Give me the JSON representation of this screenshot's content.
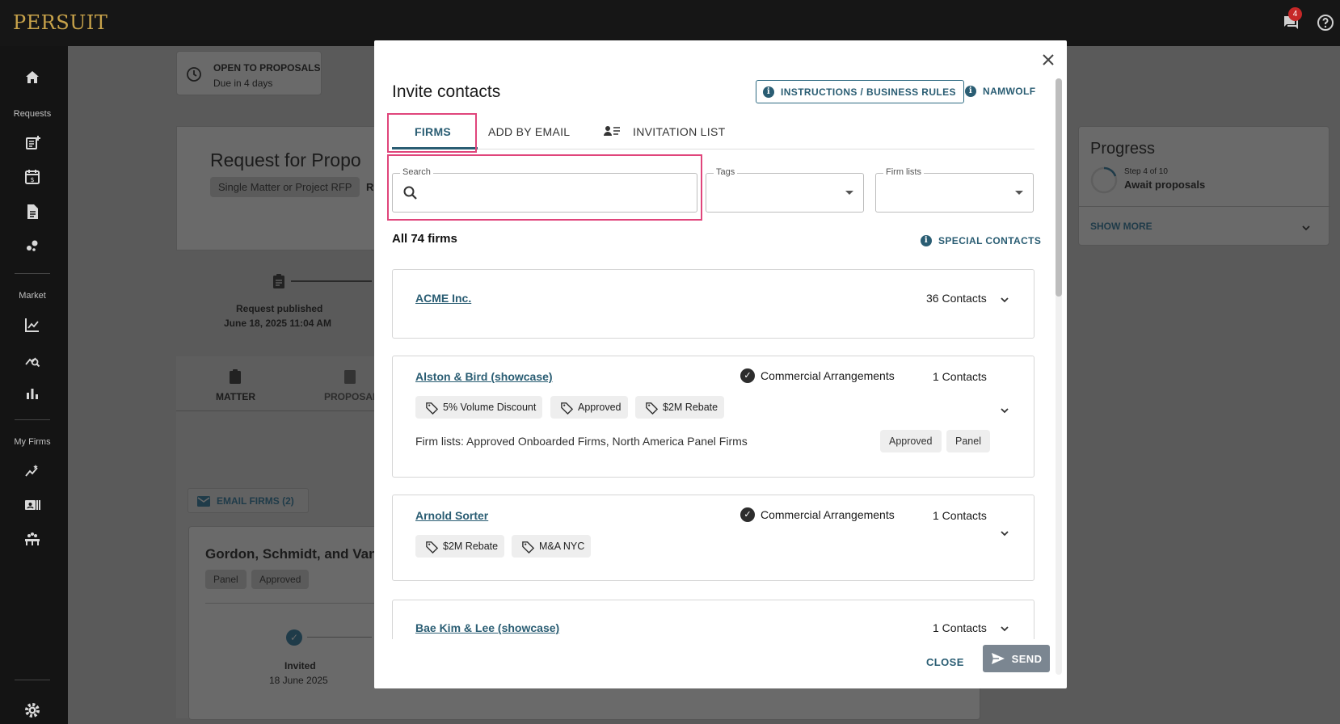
{
  "app": {
    "logo": "PERSUIT",
    "notifications_count": "4"
  },
  "sidebar": {
    "sections": {
      "requests": "Requests",
      "market": "Market",
      "my_firms": "My Firms"
    }
  },
  "background": {
    "status": {
      "title": "OPEN TO PROPOSALS",
      "due": "Due in 4 days"
    },
    "request_title": "Request for Propo",
    "type_chip": "Single Matter or Project RFP",
    "type_chip_more": "R",
    "timeline": {
      "published_label": "Request published",
      "published_date": "June 18, 2025 11:04 AM"
    },
    "tabs": [
      "MATTER",
      "PROPOSAL"
    ],
    "email_firms": "EMAIL FIRMS (2)",
    "firm_card": {
      "name": "Gordon, Schmidt, and Van",
      "chips": [
        "Panel",
        "Approved"
      ],
      "step_label": "Invited",
      "step_date": "18 June 2025"
    },
    "progress": {
      "title": "Progress",
      "step": "Step 4 of 10",
      "step_name": "Await proposals",
      "show_more": "SHOW MORE"
    }
  },
  "modal": {
    "title": "Invite contacts",
    "instructions_button": "INSTRUCTIONS / BUSINESS RULES",
    "namwolf_button": "NAMWOLF",
    "tabs": [
      {
        "label": "FIRMS",
        "active": true
      },
      {
        "label": "ADD BY EMAIL",
        "active": false
      },
      {
        "label": "INVITATION LIST",
        "active": false
      }
    ],
    "filters": {
      "search_label": "Search",
      "search_value": "",
      "tags_label": "Tags",
      "tags_value": "",
      "firm_lists_label": "Firm lists",
      "firm_lists_value": ""
    },
    "firm_count": "All 74 firms",
    "special_contacts": "SPECIAL CONTACTS",
    "firms": [
      {
        "name": "ACME Inc.",
        "contacts": "36 Contacts"
      },
      {
        "name": "Alston & Bird (showcase)",
        "commercial": "Commercial Arrangements",
        "contacts": "1 Contacts",
        "tags": [
          "5% Volume Discount",
          "Approved",
          "$2M Rebate"
        ],
        "firm_lists": "Firm lists: Approved Onboarded Firms, North America Panel Firms",
        "pills": [
          "Approved",
          "Panel"
        ]
      },
      {
        "name": "Arnold Sorter",
        "commercial": "Commercial Arrangements",
        "contacts": "1 Contacts",
        "tags": [
          "$2M Rebate",
          "M&A NYC"
        ]
      },
      {
        "name": "Bae Kim & Lee (showcase)",
        "contacts": "1 Contacts"
      }
    ],
    "footer": {
      "close": "CLOSE",
      "send": "SEND"
    }
  },
  "colors": {
    "accent": "#2a5d73",
    "highlight": "#e0457b",
    "logo": "#c7a24a",
    "send_disabled": "#7b8691"
  }
}
